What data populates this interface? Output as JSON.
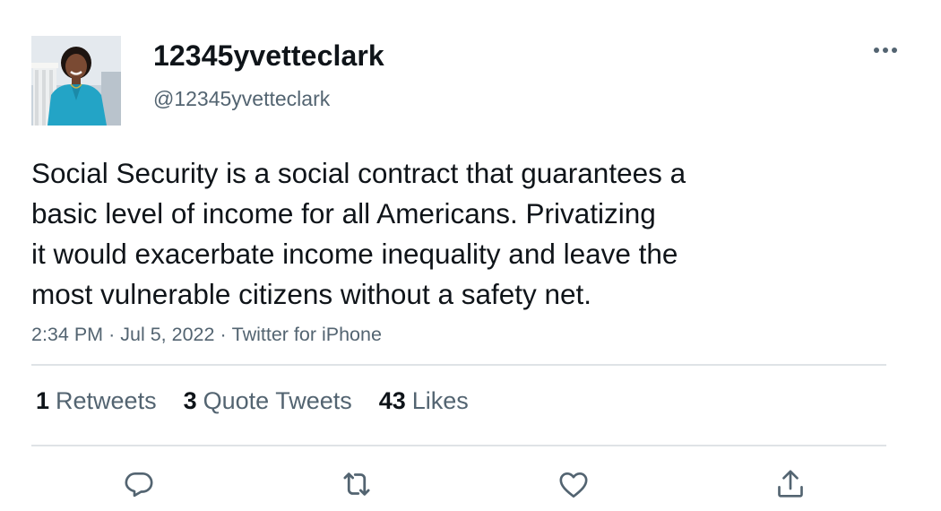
{
  "user": {
    "display_name": "12345yvetteclark",
    "handle": "@12345yvetteclark"
  },
  "tweet": {
    "text_lines": [
      "Social Security is a social contract that guarantees a",
      "basic level of income for all Americans. Privatizing",
      "it would exacerbate income inequality and leave the",
      "most vulnerable citizens without a safety net."
    ],
    "time": "2:34 PM",
    "date": "Jul 5, 2022",
    "source": "Twitter for iPhone",
    "separator": "·"
  },
  "stats": {
    "retweets": {
      "count": "1",
      "label": "Retweets"
    },
    "quotes": {
      "count": "3",
      "label": "Quote Tweets"
    },
    "likes": {
      "count": "43",
      "label": "Likes"
    }
  },
  "icons": {
    "more": "more-dots-icon",
    "reply": "reply-icon",
    "retweet": "retweet-icon",
    "like": "heart-icon",
    "share": "share-icon"
  },
  "colors": {
    "text_primary": "#0f1419",
    "text_secondary": "#536471",
    "divider": "#dfe3e6",
    "icon": "#536471"
  }
}
